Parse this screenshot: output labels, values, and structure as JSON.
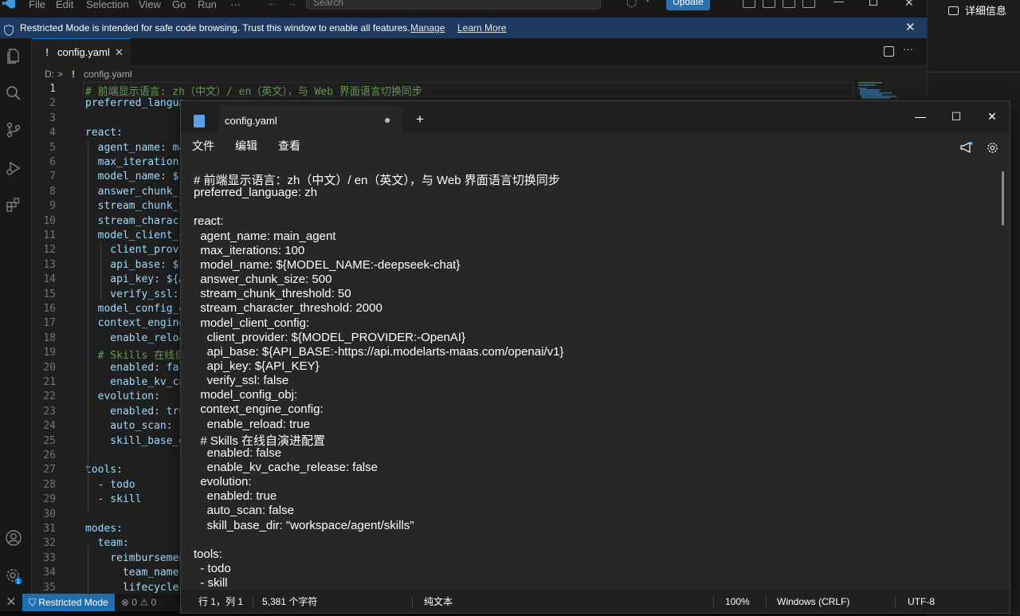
{
  "vscode": {
    "menu": [
      "File",
      "Edit",
      "Selection",
      "View",
      "Go",
      "Run",
      "···"
    ],
    "search_placeholder": "Search",
    "update_label": "Update",
    "banner": {
      "message": "Restricted Mode is intended for safe code browsing. Trust this window to enable all features.",
      "manage": "Manage",
      "learn_more": "Learn More"
    },
    "tab": {
      "modified_mark": "!",
      "name": "config.yaml",
      "close": "✕"
    },
    "breadcrumb": {
      "drive": "D:",
      "sep": ">",
      "mark": "!",
      "file": "config.yaml"
    },
    "line_numbers": [
      "1",
      "2",
      "3",
      "4",
      "5",
      "6",
      "7",
      "8",
      "9",
      "10",
      "11",
      "12",
      "13",
      "14",
      "15",
      "16",
      "17",
      "18",
      "19",
      "20",
      "21",
      "22",
      "23",
      "24",
      "25",
      "26",
      "27",
      "28",
      "29",
      "30",
      "31",
      "32",
      "33",
      "34",
      "35"
    ],
    "code_lines": [
      "# 前端显示语言: zh（中文）/ en（英文），与 Web 界面语言切换同步",
      "preferred_langua",
      "",
      "react:",
      "  agent_name: ma",
      "  max_iteration",
      "  model_name: ${",
      "  answer_chunk_s",
      "  stream_chunk_t",
      "  stream_charact",
      "  model_client_c",
      "    client_provi",
      "    api_base: ${",
      "    api_key: ${A",
      "    verify_ssl: ",
      "  model_config_o",
      "  context_engine",
      "    enable_reloa",
      "  # Skills 在线自",
      "    enabled: fal",
      "    enable_kv_ca",
      "  evolution:",
      "    enabled: tru",
      "    auto_scan: f",
      "    skill_base_d",
      "",
      "tools:",
      "  - todo",
      "  - skill",
      "",
      "modes:",
      "  team:",
      "    reimbursemen",
      "      team_name:",
      "      lifecycle:"
    ],
    "status": {
      "restricted": "Restricted Mode",
      "errors": "0",
      "warnings": "0"
    },
    "details_label": "详细信息"
  },
  "notepad": {
    "tab_name": "config.yaml",
    "modified_dot": "●",
    "new_tab": "+",
    "menu": [
      "文件",
      "编辑",
      "查看"
    ],
    "lines": [
      "# 前端显示语言：zh（中文）/ en（英文），与 Web 界面语言切换同步",
      "preferred_language: zh",
      "",
      "react:",
      "  agent_name: main_agent",
      "  max_iterations: 100",
      "  model_name: ${MODEL_NAME:-deepseek-chat}",
      "  answer_chunk_size: 500",
      "  stream_chunk_threshold: 50",
      "  stream_character_threshold: 2000",
      "  model_client_config:",
      "    client_provider: ${MODEL_PROVIDER:-OpenAI}",
      "    api_base: ${API_BASE:-https://api.modelarts-maas.com/openai/v1}",
      "    api_key: ${API_KEY}",
      "    verify_ssl: false",
      "  model_config_obj:",
      "  context_engine_config:",
      "    enable_reload: true",
      "  # Skills 在线自演进配置",
      "    enabled: false",
      "    enable_kv_cache_release: false",
      "  evolution:",
      "    enabled: true",
      "    auto_scan: false",
      "    skill_base_dir: \"workspace/agent/skills\"",
      "",
      "tools:",
      "  - todo",
      "  - skill"
    ],
    "status": {
      "position": "行 1，列 1",
      "chars": "5,381 个字符",
      "type": "纯文本",
      "zoom": "100%",
      "eol": "Windows (CRLF)",
      "encoding": "UTF-8"
    }
  },
  "colors": {
    "accent": "#0078d4",
    "banner": "#1e3a5f",
    "restricted_badge": "#1f6fae",
    "yaml_key": "#9cdcfe",
    "yaml_comment": "#6a9955"
  }
}
